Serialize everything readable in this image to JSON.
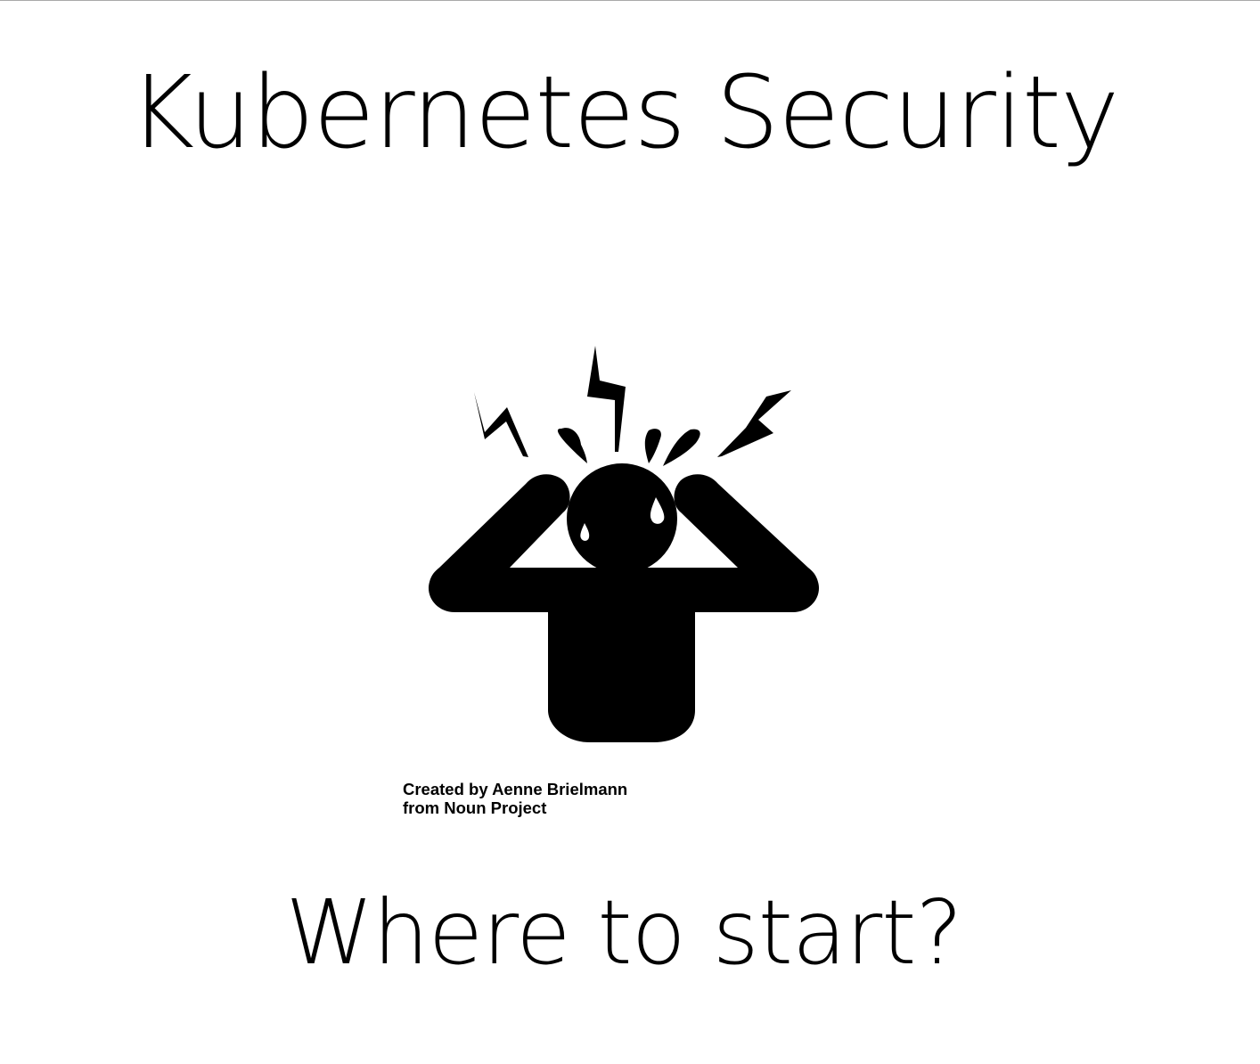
{
  "slide": {
    "title": "Kubernetes Security",
    "subtitle": "Where to start?",
    "credit": {
      "line1": "Created by Aenne Brielmann",
      "line2": "from Noun Project"
    },
    "illustration_icon": "stressed-person-icon"
  },
  "colors": {
    "background": "#ffffff",
    "ink": "#000000",
    "border": "#a9a9a9"
  }
}
